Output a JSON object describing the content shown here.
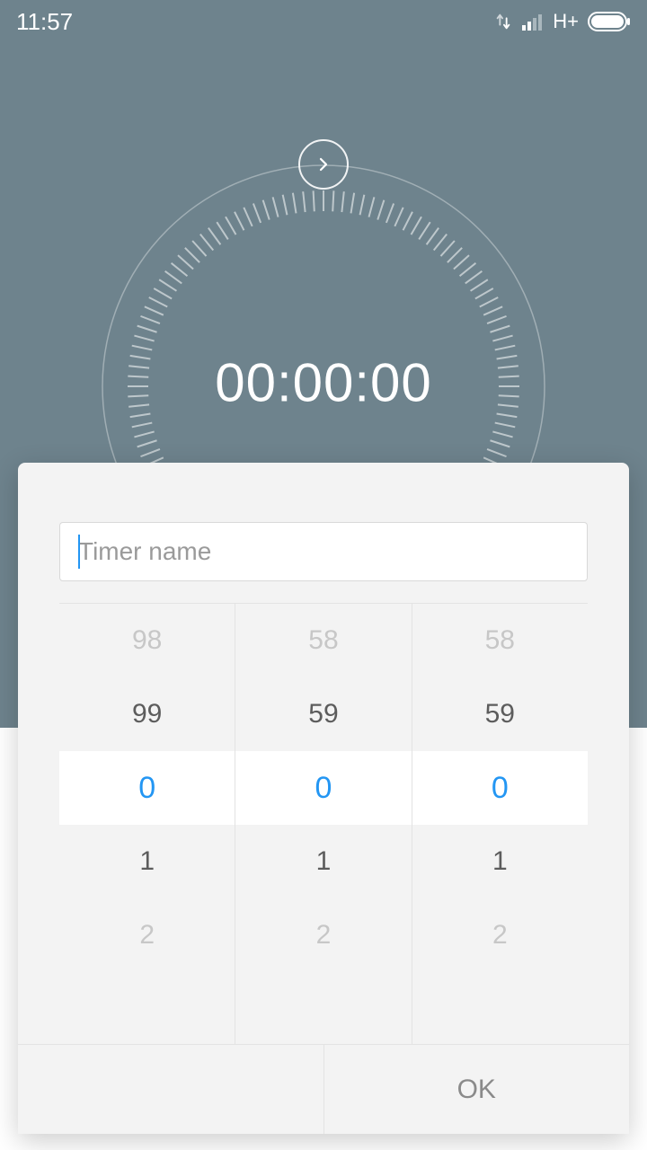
{
  "status": {
    "time": "11:57",
    "network": "H+"
  },
  "timer": {
    "display": "00:00:00",
    "input_placeholder": "Timer name",
    "input_value": ""
  },
  "picker": {
    "hours": {
      "values": [
        "98",
        "99",
        "0",
        "1",
        "2"
      ],
      "selected_index": 2
    },
    "minutes": {
      "values": [
        "58",
        "59",
        "0",
        "1",
        "2"
      ],
      "selected_index": 2
    },
    "seconds": {
      "values": [
        "58",
        "59",
        "0",
        "1",
        "2"
      ],
      "selected_index": 2
    }
  },
  "dialog": {
    "cancel_label": "",
    "ok_label": "OK"
  },
  "colors": {
    "accent": "#2396f3",
    "bg": "#6e838d"
  }
}
